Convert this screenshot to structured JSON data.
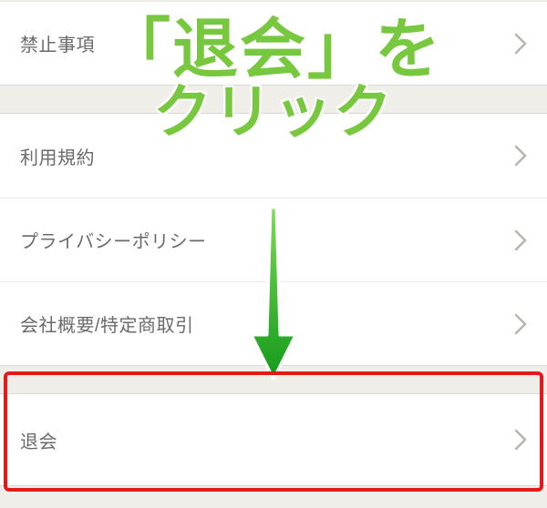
{
  "menu": {
    "group1": {
      "items": [
        {
          "label": "禁止事項"
        }
      ]
    },
    "group2": {
      "items": [
        {
          "label": "利用規約"
        },
        {
          "label": "プライバシーポリシー"
        },
        {
          "label": "会社概要/特定商取引"
        }
      ]
    },
    "group3": {
      "items": [
        {
          "label": "退会"
        }
      ]
    }
  },
  "annotation": {
    "line1": "「退会」を",
    "line2": "クリック"
  },
  "colors": {
    "highlight_border": "#e11b1b",
    "annotation_text": "#77c83e",
    "arrow_fill": "#1aa321",
    "row_text": "#6a6a6a",
    "bg": "#efeee9"
  }
}
